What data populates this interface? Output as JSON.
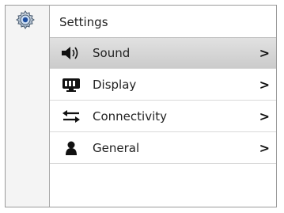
{
  "sidebar": {
    "category_icon": "gear-icon"
  },
  "header": {
    "title": "Settings"
  },
  "menu": {
    "items": [
      {
        "label": "Sound",
        "icon": "speaker-icon",
        "chevron": ">",
        "selected": true
      },
      {
        "label": "Display",
        "icon": "monitor-icon",
        "chevron": ">"
      },
      {
        "label": "Connectivity",
        "icon": "arrows-icon",
        "chevron": ">"
      },
      {
        "label": "General",
        "icon": "person-icon",
        "chevron": ">"
      }
    ]
  },
  "colors": {
    "selected_row": "#d4d4d4",
    "border": "#9a9a9a"
  }
}
